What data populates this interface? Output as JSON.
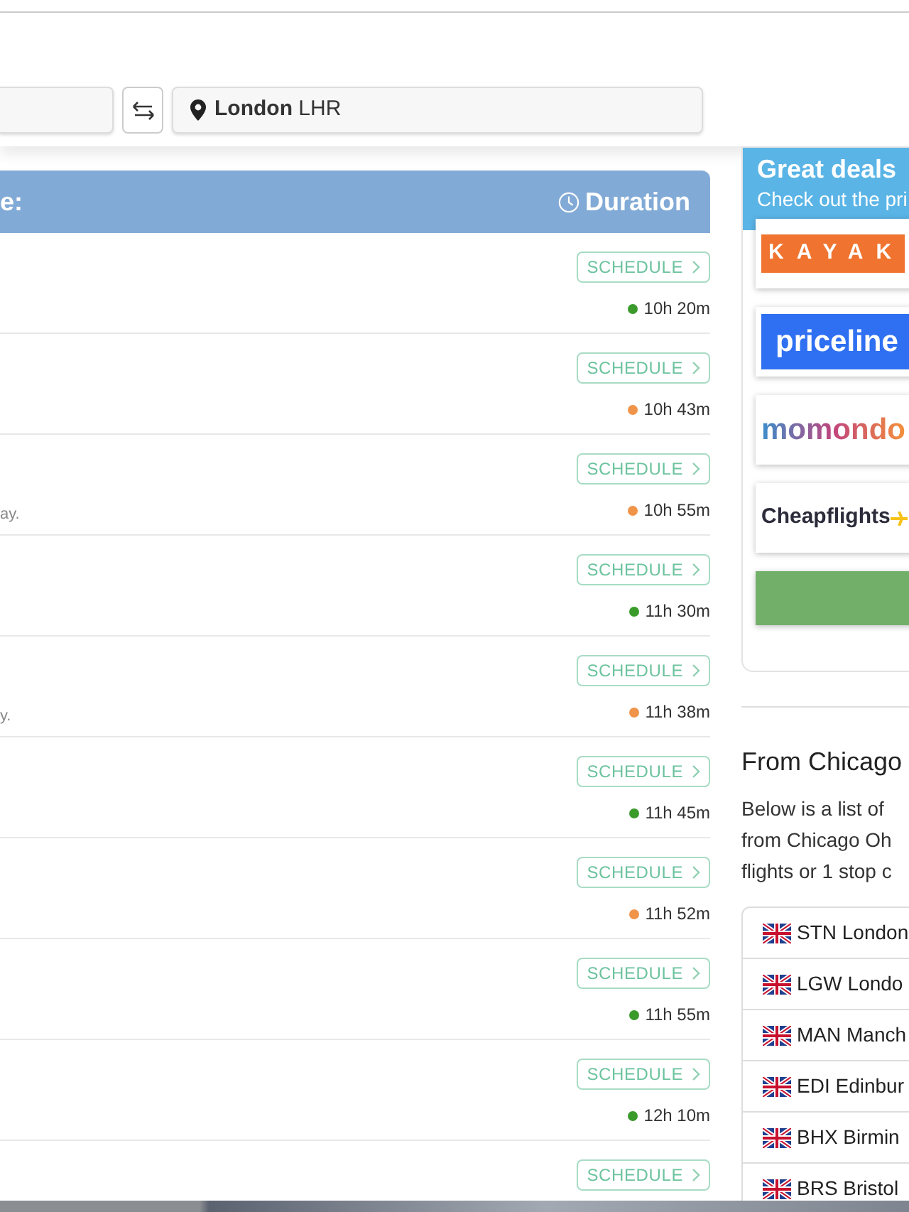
{
  "search": {
    "destination": {
      "city": "London",
      "code": "LHR"
    }
  },
  "results": {
    "header": {
      "title": "e:",
      "sort_label": "Duration"
    },
    "rows": [
      {
        "button": "SCHEDULE",
        "duration": "10h 20m",
        "color": "#3a9b2b"
      },
      {
        "button": "SCHEDULE",
        "duration": "10h 43m",
        "color": "#f0944a"
      },
      {
        "note": "ay.",
        "button": "SCHEDULE",
        "duration": "10h 55m",
        "color": "#f0944a"
      },
      {
        "button": "SCHEDULE",
        "duration": "11h 30m",
        "color": "#3a9b2b"
      },
      {
        "note": "y.",
        "button": "SCHEDULE",
        "duration": "11h 38m",
        "color": "#f0944a"
      },
      {
        "button": "SCHEDULE",
        "duration": "11h 45m",
        "color": "#3a9b2b"
      },
      {
        "button": "SCHEDULE",
        "duration": "11h 52m",
        "color": "#f0944a"
      },
      {
        "button": "SCHEDULE",
        "duration": "11h 55m",
        "color": "#3a9b2b"
      },
      {
        "button": "SCHEDULE",
        "duration": "12h 10m",
        "color": "#3a9b2b"
      },
      {
        "button": "SCHEDULE"
      }
    ]
  },
  "deals": {
    "title": "Great deals",
    "subtitle": "Check out the pri",
    "providers": [
      {
        "kind": "kayak",
        "label": "KAYAK"
      },
      {
        "kind": "priceline",
        "label": "priceline"
      },
      {
        "kind": "momondo",
        "label": "momondo"
      },
      {
        "kind": "cheapflights",
        "label": "Cheapflights"
      },
      {
        "kind": "cta"
      }
    ]
  },
  "destinations": {
    "title": "From Chicago",
    "intro_lines": [
      "Below is a list of",
      "from Chicago Oh",
      "flights or 1 stop c"
    ],
    "airports": [
      "STN London",
      "LGW Londo",
      "MAN Manch",
      "EDI Edinbur",
      "BHX Birmin",
      "BRS Bristol"
    ]
  }
}
